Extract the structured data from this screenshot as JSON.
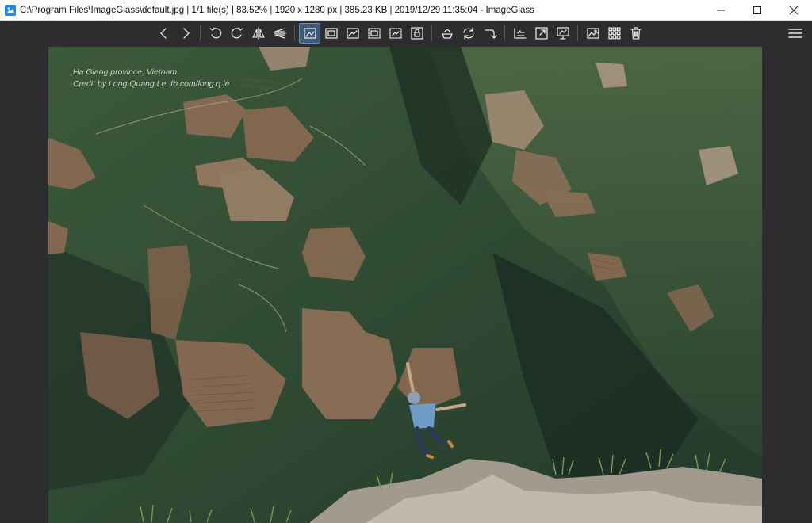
{
  "window": {
    "title": "C:\\Program Files\\ImageGlass\\default.jpg  |  1/1 file(s)  |  83.52%  |  1920 x 1280 px  |  385.23 KB  |  2019/12/29 11:35:04  - ImageGlass",
    "app_icon": "imageglass-logo-icon",
    "controls": [
      "minimize-icon",
      "maximize-icon",
      "close-icon"
    ]
  },
  "toolbar": {
    "groups": [
      [
        "previous-image-icon",
        "next-image-icon"
      ],
      [
        "rotate-left-icon",
        "rotate-right-icon",
        "flip-horizontal-icon",
        "flip-vertical-icon"
      ],
      [
        "auto-zoom-icon",
        "lock-zoom-ratio-icon",
        "scale-to-width-icon",
        "scale-to-height-icon",
        "scale-to-fit-icon",
        "lock-zoom-icon"
      ],
      [
        "open-with-icon",
        "refresh-icon",
        "goto-image-icon"
      ],
      [
        "checkerboard-icon",
        "fullscreen-icon",
        "slideshow-icon"
      ],
      [
        "set-wallpaper-icon",
        "thumbnail-icon",
        "delete-icon"
      ]
    ],
    "active": "auto-zoom-icon",
    "menu_icon": "hamburger-menu-icon"
  },
  "image": {
    "caption_line1": "Ha Giang province, Vietnam",
    "caption_line2": "Credit by Long Quang Le. fb.com/long.q.le"
  },
  "colors": {
    "toolbar_bg": "#2d2d30",
    "active_button": "#3d5a7a",
    "icon": "#e6e6e6"
  }
}
